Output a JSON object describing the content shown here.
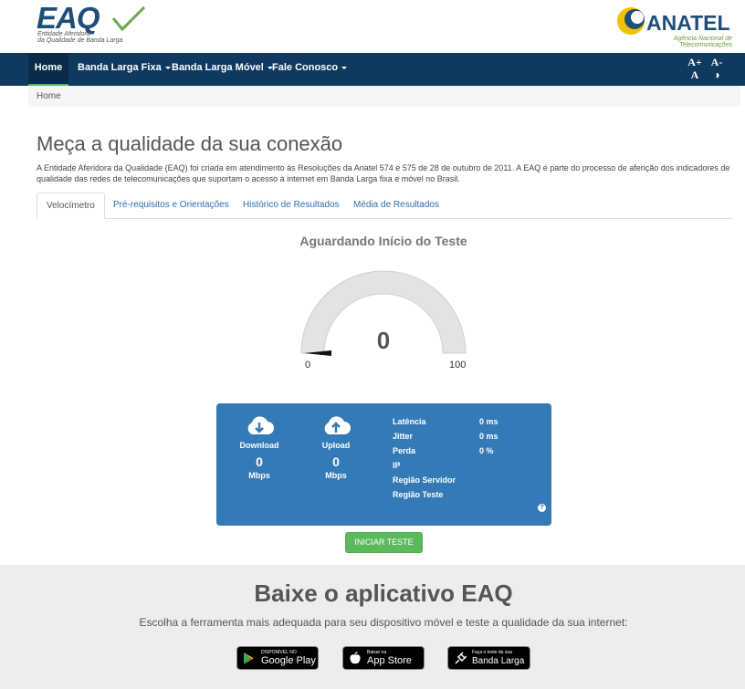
{
  "header": {
    "eaq_logo_text": "EAQ",
    "eaq_logo_sub1": "Entidade Aferidora",
    "eaq_logo_sub2": "da Qualidade de Banda Larga",
    "anatel_logo_text": "ANATEL",
    "anatel_logo_sub": "Agência Nacional de Telecomunicações"
  },
  "nav": {
    "items": [
      {
        "label": "Home"
      },
      {
        "label": "Banda Larga Fixa"
      },
      {
        "label": "Banda Larga Móvel"
      },
      {
        "label": "Fale Conosco"
      }
    ],
    "font_increase": "A+",
    "font_decrease": "A-",
    "font_reset": "A",
    "contrast": "◑"
  },
  "breadcrumb": {
    "home": "Home"
  },
  "page": {
    "title": "Meça a qualidade da sua conexão",
    "intro": "A Entidade Aferidora da Qualidade (EAQ) foi criada em atendimento às Resoluções da Anatel 574 e 575 de 28 de outubro de 2011. A EAQ é parte do processo de aferição dos indicadores de qualidade das redes de telecomunicações que suportam o acesso à internet em Banda Larga fixa e móvel no Brasil."
  },
  "tabs": [
    {
      "label": "Velocímetro"
    },
    {
      "label": "Pré-requisitos e Orientações"
    },
    {
      "label": "Histórico de Resultados"
    },
    {
      "label": "Média de Resultados"
    }
  ],
  "gauge": {
    "status": "Aguardando Início do Teste",
    "value": "0",
    "min": "0",
    "max": "100"
  },
  "results": {
    "download": {
      "label": "Download",
      "value": "0",
      "unit": "Mbps"
    },
    "upload": {
      "label": "Upload",
      "value": "0",
      "unit": "Mbps"
    },
    "stats": [
      {
        "label": "Latência",
        "value": "0 ms"
      },
      {
        "label": "Jitter",
        "value": "0 ms"
      },
      {
        "label": "Perda",
        "value": "0 %"
      },
      {
        "label": "IP",
        "value": ""
      },
      {
        "label": "Região Servidor",
        "value": ""
      },
      {
        "label": "Região Teste",
        "value": ""
      }
    ],
    "help": "?"
  },
  "start_button": "INICIAR TESTE",
  "footer": {
    "title": "Baixe o aplicativo EAQ",
    "subtitle": "Escolha a ferramenta mais adequada para seu dispositivo móvel e teste a qualidade da sua internet:",
    "stores": [
      {
        "small": "DISPONÍVEL NO",
        "big": "Google Play"
      },
      {
        "small": "Baixar na",
        "big": "App Store"
      },
      {
        "small": "Faça o teste da sua",
        "big": "Banda Larga"
      }
    ]
  },
  "colors": {
    "navbar": "#0f3a5f",
    "panel": "#337ab7",
    "start_button": "#5cb85c"
  }
}
